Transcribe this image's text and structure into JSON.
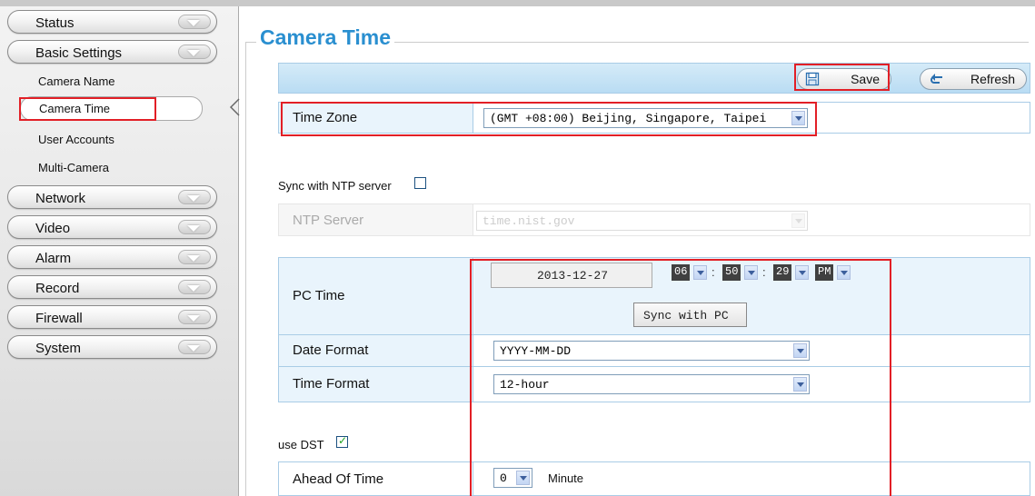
{
  "sidebar": {
    "status": "Status",
    "basic_settings": "Basic Settings",
    "sub_items": [
      "Camera Name",
      "Camera Time",
      "User Accounts",
      "Multi-Camera"
    ],
    "network": "Network",
    "video": "Video",
    "alarm": "Alarm",
    "record": "Record",
    "firewall": "Firewall",
    "system": "System"
  },
  "page": {
    "title": "Camera Time"
  },
  "toolbar": {
    "save_label": "Save",
    "refresh_label": "Refresh"
  },
  "time_zone": {
    "label": "Time Zone",
    "value": "(GMT +08:00) Beijing, Singapore, Taipei"
  },
  "ntp": {
    "sync_label": "Sync with NTP server",
    "sync_checked": false,
    "server_label": "NTP Server",
    "server_value": "time.nist.gov"
  },
  "pc_time": {
    "label": "PC Time",
    "date": "2013-12-27",
    "hour": "06",
    "minute": "50",
    "second": "29",
    "ampm": "PM",
    "sync_button": "Sync with PC"
  },
  "date_format": {
    "label": "Date Format",
    "value": "YYYY-MM-DD"
  },
  "time_format": {
    "label": "Time Format",
    "value": "12-hour"
  },
  "dst": {
    "label": "use DST",
    "checked": true
  },
  "ahead_of_time": {
    "label": "Ahead Of Time",
    "value": "0",
    "unit": "Minute"
  },
  "colors": {
    "accent": "#2a8fd0",
    "highlight": "#e21f26",
    "header_blue": "#b9dcf3"
  }
}
